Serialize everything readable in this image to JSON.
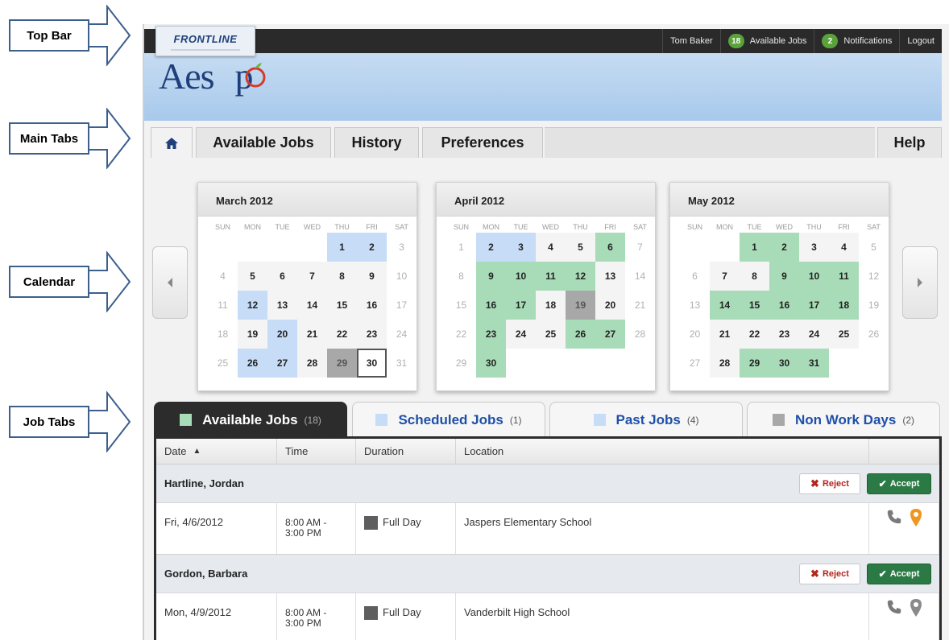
{
  "annotations": {
    "top_bar": "Top Bar",
    "main_tabs": "Main Tabs",
    "calendar": "Calendar",
    "job_tabs": "Job Tabs"
  },
  "topbar": {
    "logo": "FRONTLINE",
    "user": "Tom Baker",
    "available_count": "18",
    "available_label": "Available Jobs",
    "notifications_count": "2",
    "notifications_label": "Notifications",
    "logout": "Logout"
  },
  "banner": {
    "brand_left": "Aes",
    "brand_right": "p"
  },
  "main_tabs": {
    "home_icon": "home-icon",
    "available": "Available Jobs",
    "history": "History",
    "preferences": "Preferences",
    "help": "Help"
  },
  "calendar": {
    "dow": [
      "SUN",
      "MON",
      "TUE",
      "WED",
      "THU",
      "FRI",
      "SAT"
    ],
    "months": [
      {
        "title": "March 2012",
        "lead": 4,
        "days": 31,
        "scheduled": [
          1,
          2,
          12,
          20,
          26,
          27
        ],
        "available": [],
        "nonwork": [
          29
        ],
        "today": [
          30
        ]
      },
      {
        "title": "April 2012",
        "lead": 0,
        "days": 30,
        "scheduled": [
          2,
          3
        ],
        "available": [
          6,
          9,
          10,
          11,
          12,
          16,
          17,
          23,
          26,
          27,
          30
        ],
        "nonwork": [
          19
        ],
        "today": []
      },
      {
        "title": "May 2012",
        "lead": 2,
        "days": 31,
        "scheduled": [],
        "available": [
          1,
          2,
          9,
          10,
          11,
          14,
          15,
          16,
          17,
          18,
          29,
          30,
          31
        ],
        "nonwork": [],
        "today": []
      }
    ],
    "colors": {
      "scheduled": "#c6dcf7",
      "available": "#a8dcb8",
      "nonwork": "#a8a8a8"
    }
  },
  "job_tabs": [
    {
      "label": "Available Jobs",
      "count": "(18)",
      "color": "#a8dcb8"
    },
    {
      "label": "Scheduled Jobs",
      "count": "(1)",
      "color": "#c6dcf7"
    },
    {
      "label": "Past Jobs",
      "count": "(4)",
      "color": "#c6dcf7"
    },
    {
      "label": "Non Work Days",
      "count": "(2)",
      "color": "#a8a8a8"
    }
  ],
  "table": {
    "headers": {
      "date": "Date",
      "time": "Time",
      "duration": "Duration",
      "location": "Location"
    },
    "reject_label": "Reject",
    "accept_label": "Accept",
    "jobs": [
      {
        "name": "Hartline, Jordan",
        "date": "Fri, 4/6/2012",
        "time_start": "8:00 AM -",
        "time_end": "3:00 PM",
        "duration": "Full Day",
        "location": "Jaspers Elementary School",
        "pin_color": "#f0961e"
      },
      {
        "name": "Gordon, Barbara",
        "date": "Mon, 4/9/2012",
        "time_start": "8:00 AM -",
        "time_end": "3:00 PM",
        "duration": "Full Day",
        "location": "Vanderbilt High School",
        "pin_color": "#8a8a8a"
      }
    ]
  }
}
